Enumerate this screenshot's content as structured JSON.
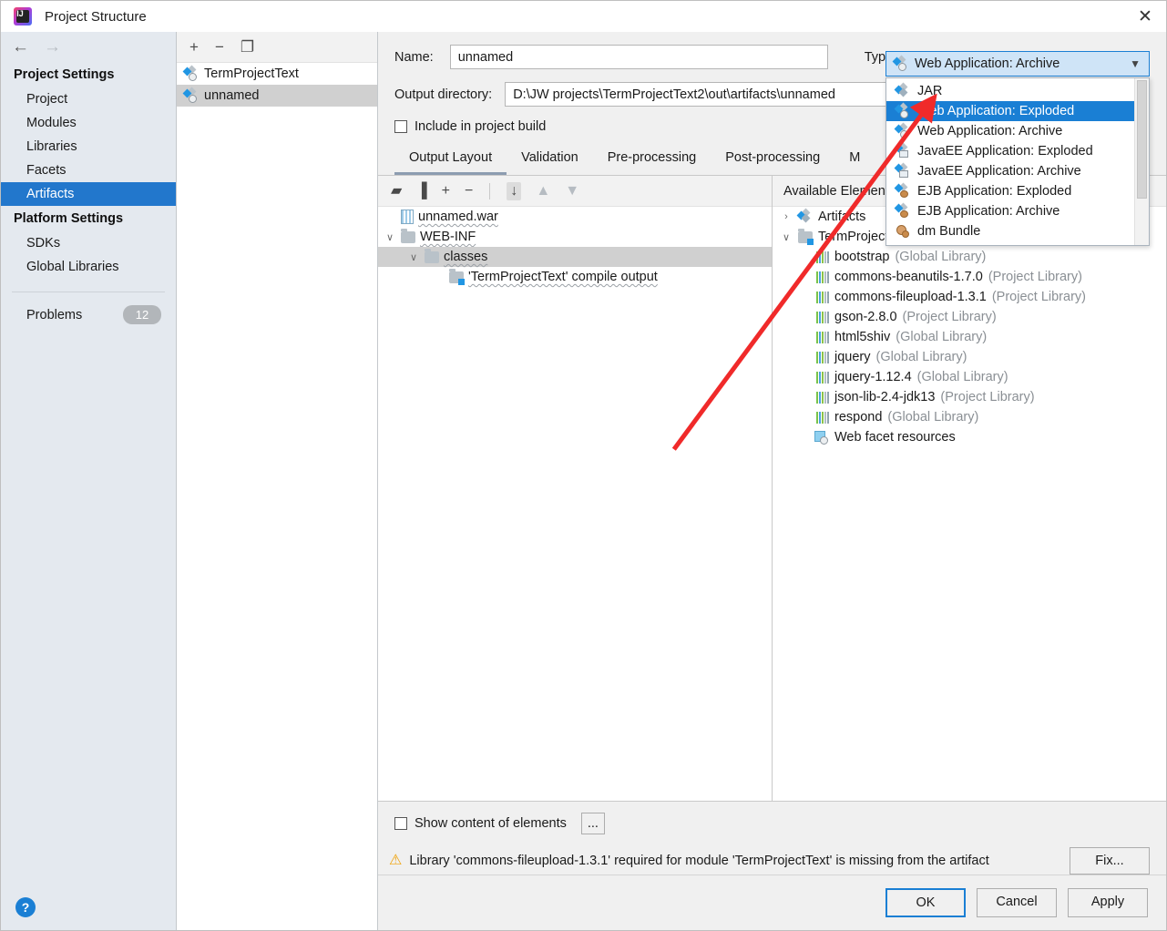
{
  "window": {
    "title": "Project Structure",
    "app_icon": "intellij-idea-icon",
    "close_label": "✕"
  },
  "nav": {
    "back": "←",
    "forward": "→"
  },
  "sidebar": {
    "groups": [
      {
        "title": "Project Settings",
        "items": [
          {
            "label": "Project",
            "selected": false
          },
          {
            "label": "Modules",
            "selected": false
          },
          {
            "label": "Libraries",
            "selected": false
          },
          {
            "label": "Facets",
            "selected": false
          },
          {
            "label": "Artifacts",
            "selected": true
          }
        ]
      },
      {
        "title": "Platform Settings",
        "items": [
          {
            "label": "SDKs",
            "selected": false
          },
          {
            "label": "Global Libraries",
            "selected": false
          }
        ]
      }
    ],
    "problems": {
      "label": "Problems",
      "count": "12"
    },
    "help_label": "?"
  },
  "artifact_list": {
    "toolbar": [
      {
        "name": "add-artifact-button",
        "glyph": "+"
      },
      {
        "name": "remove-artifact-button",
        "glyph": "−"
      },
      {
        "name": "copy-artifact-button",
        "glyph": "❐"
      }
    ],
    "items": [
      {
        "label": "TermProjectText",
        "icon": "web-application-icon",
        "selected": false
      },
      {
        "label": "unnamed",
        "icon": "web-application-icon",
        "selected": true
      }
    ]
  },
  "form": {
    "name_label": "Name:",
    "name_value": "unnamed",
    "type_label": "Type:",
    "type_value": "Web Application: Archive",
    "outdir_label": "Output directory:",
    "outdir_value": "D:\\JW projects\\TermProjectText2\\out\\artifacts\\unnamed",
    "include_label": "Include in project build",
    "include_checked": false
  },
  "type_dropdown": {
    "options": [
      {
        "label": "JAR",
        "icon": "jar-icon",
        "selected": false
      },
      {
        "label": "Web Application: Exploded",
        "icon": "web-application-icon",
        "selected": true
      },
      {
        "label": "Web Application: Archive",
        "icon": "web-application-icon",
        "selected": false
      },
      {
        "label": "JavaEE Application: Exploded",
        "icon": "javaee-application-icon",
        "selected": false
      },
      {
        "label": "JavaEE Application: Archive",
        "icon": "javaee-application-icon",
        "selected": false
      },
      {
        "label": "EJB Application: Exploded",
        "icon": "ejb-application-icon",
        "selected": false
      },
      {
        "label": "EJB Application: Archive",
        "icon": "ejb-application-icon",
        "selected": false
      },
      {
        "label": "dm Bundle",
        "icon": "dm-bundle-icon",
        "selected": false
      }
    ]
  },
  "tabs": [
    {
      "label": "Output Layout",
      "active": true
    },
    {
      "label": "Validation",
      "active": false
    },
    {
      "label": "Pre-processing",
      "active": false
    },
    {
      "label": "Post-processing",
      "active": false
    },
    {
      "label": "M",
      "active": false
    }
  ],
  "tree_toolbar": [
    {
      "name": "add-directory-button",
      "glyph": "▰"
    },
    {
      "name": "add-archive-button",
      "glyph": "▐"
    },
    {
      "name": "add-element-button",
      "glyph": "+"
    },
    {
      "name": "remove-element-button",
      "glyph": "−"
    },
    {
      "name": "sort-alphabetically-button",
      "glyph": "↓"
    },
    {
      "name": "move-up-button",
      "glyph": "▲"
    },
    {
      "name": "move-down-button",
      "glyph": "▼"
    }
  ],
  "output_tree": [
    {
      "label": "unnamed.war",
      "icon": "archive-icon",
      "indent": 0,
      "caret": "",
      "selected": false
    },
    {
      "label": "WEB-INF",
      "icon": "folder-icon",
      "indent": 1,
      "caret": "∨",
      "selected": false
    },
    {
      "label": "classes",
      "icon": "folder-icon",
      "indent": 2,
      "caret": "∨",
      "selected": true
    },
    {
      "label": "'TermProjectText' compile output",
      "icon": "module-output-icon",
      "indent": 3,
      "caret": "",
      "selected": false
    }
  ],
  "available": {
    "header": "Available Elements",
    "items": [
      {
        "label": "Artifacts",
        "kind": "",
        "icon": "jar-icon",
        "indent": 0,
        "caret": "›"
      },
      {
        "label": "TermProjectText",
        "kind": "",
        "icon": "module-output-icon",
        "indent": 0,
        "caret": "∨"
      },
      {
        "label": "bootstrap",
        "kind": "(Global Library)",
        "icon": "library-icon",
        "indent": 1,
        "caret": ""
      },
      {
        "label": "commons-beanutils-1.7.0",
        "kind": "(Project Library)",
        "icon": "library-icon",
        "indent": 1,
        "caret": ""
      },
      {
        "label": "commons-fileupload-1.3.1",
        "kind": "(Project Library)",
        "icon": "library-icon",
        "indent": 1,
        "caret": ""
      },
      {
        "label": "gson-2.8.0",
        "kind": "(Project Library)",
        "icon": "library-icon",
        "indent": 1,
        "caret": ""
      },
      {
        "label": "html5shiv",
        "kind": "(Global Library)",
        "icon": "library-icon",
        "indent": 1,
        "caret": ""
      },
      {
        "label": "jquery",
        "kind": "(Global Library)",
        "icon": "library-icon",
        "indent": 1,
        "caret": ""
      },
      {
        "label": "jquery-1.12.4",
        "kind": "(Global Library)",
        "icon": "library-icon",
        "indent": 1,
        "caret": ""
      },
      {
        "label": "json-lib-2.4-jdk13",
        "kind": "(Project Library)",
        "icon": "library-icon",
        "indent": 1,
        "caret": ""
      },
      {
        "label": "respond",
        "kind": "(Global Library)",
        "icon": "library-icon",
        "indent": 1,
        "caret": ""
      },
      {
        "label": "Web facet resources",
        "kind": "",
        "icon": "web-resources-icon",
        "indent": 1,
        "caret": ""
      }
    ]
  },
  "bottom": {
    "show_content_label": "Show content of elements",
    "show_content_checked": false,
    "ellipsis_label": "...",
    "warning_text": "Library 'commons-fileupload-1.3.1' required for module 'TermProjectText' is missing from the artifact",
    "fix_label": "Fix..."
  },
  "footer": {
    "ok_label": "OK",
    "cancel_label": "Cancel",
    "apply_label": "Apply"
  },
  "annotation": {
    "arrow_color": "#f02a2a"
  },
  "colors": {
    "selection_blue": "#2277cc",
    "dropdown_selection": "#1a7fd4",
    "row_selection_gray": "#d0d0d0",
    "sidebar_bg": "#e4e9ef",
    "warning_amber": "#f0a30a"
  }
}
